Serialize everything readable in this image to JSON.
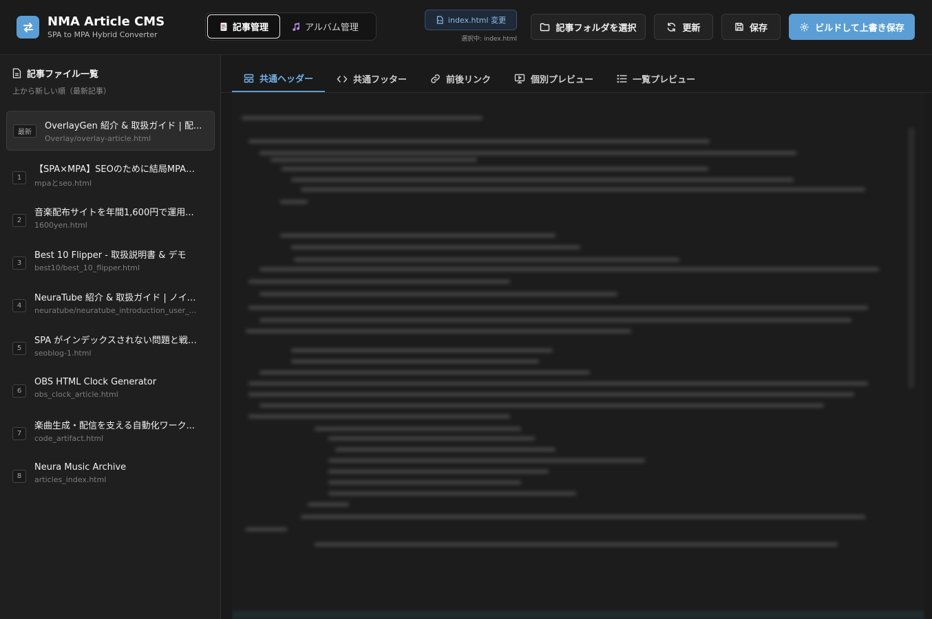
{
  "header": {
    "title": "NMA Article CMS",
    "subtitle": "SPA to MPA Hybrid Converter",
    "modes": [
      {
        "label": "記事管理",
        "active": true
      },
      {
        "label": "アルバム管理",
        "active": false
      }
    ],
    "change_indicator": "index.html 変更",
    "selecting_label": "選択中: index.html",
    "buttons": {
      "folder": "記事フォルダを選択",
      "refresh": "更新",
      "save": "保存",
      "build": "ビルドして上書き保存"
    },
    "accent_color": "#5b9ed6"
  },
  "sidebar": {
    "title": "記事ファイル一覧",
    "subtitle": "上から新しい順（最新記事）",
    "files": [
      {
        "badge": "最新",
        "title": "OverlayGen 紹介 & 取扱ガイド | 配...",
        "path": "Overlay/overlay-article.html",
        "active": true
      },
      {
        "badge": "1",
        "title": "【SPA×MPA】SEOのために結局MPA化...",
        "path": "mpaとseo.html"
      },
      {
        "badge": "2",
        "title": "音楽配布サイトを年間1,600円で運用...",
        "path": "1600yen.html"
      },
      {
        "badge": "3",
        "title": "Best 10 Flipper - 取扱説明書 & デモ",
        "path": "best10/best_10_flipper.html"
      },
      {
        "badge": "4",
        "title": "NeuraTube 紹介 & 取扱ガイド | ノイズ...",
        "path": "neuratube/neuratube_introduction_user_..."
      },
      {
        "badge": "5",
        "title": "SPA がインデックスされない問題と戦った...",
        "path": "seoblog-1.html"
      },
      {
        "badge": "6",
        "title": "OBS HTML Clock Generator",
        "path": "obs_clock_article.html"
      },
      {
        "badge": "7",
        "title": "楽曲生成・配信を支える自動化ワーク...",
        "path": "code_artifact.html"
      },
      {
        "badge": "8",
        "title": "Neura Music Archive",
        "path": "articles_index.html"
      }
    ]
  },
  "main": {
    "tabs": [
      {
        "label": "共通ヘッダー",
        "icon": "layout-icon",
        "active": true
      },
      {
        "label": "共通フッター",
        "icon": "code-icon",
        "active": false
      },
      {
        "label": "前後リンク",
        "icon": "link-icon",
        "active": false
      },
      {
        "label": "個別プレビュー",
        "icon": "monitor-icon",
        "active": false
      },
      {
        "label": "一覧プレビュー",
        "icon": "list-icon",
        "active": false
      }
    ]
  }
}
